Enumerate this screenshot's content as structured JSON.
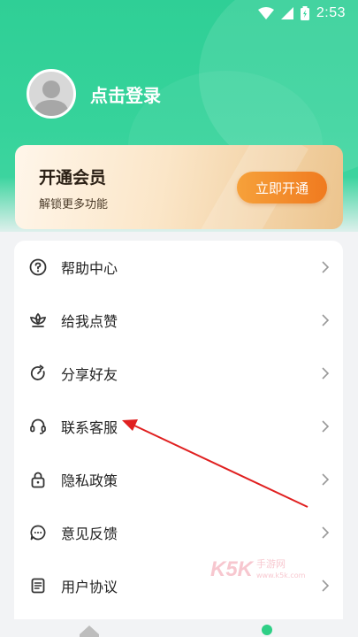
{
  "status_bar": {
    "time": "2:53"
  },
  "profile": {
    "login_label": "点击登录"
  },
  "vip": {
    "title": "开通会员",
    "subtitle": "解锁更多功能",
    "button_label": "立即开通"
  },
  "menu": {
    "items": [
      {
        "label": "帮助中心",
        "icon": "help-circle-icon"
      },
      {
        "label": "给我点赞",
        "icon": "lotus-icon"
      },
      {
        "label": "分享好友",
        "icon": "share-refresh-icon"
      },
      {
        "label": "联系客服",
        "icon": "headset-icon"
      },
      {
        "label": "隐私政策",
        "icon": "lock-icon"
      },
      {
        "label": "意见反馈",
        "icon": "chat-bubble-icon"
      },
      {
        "label": "用户协议",
        "icon": "document-icon"
      }
    ]
  },
  "watermark": {
    "logo": "K5K",
    "text_line1": "手游网",
    "text_line2": "www.k5k.com"
  },
  "colors": {
    "brand_green": "#36d39b",
    "accent_orange": "#f07a1f",
    "annotation_red": "#e02020"
  }
}
